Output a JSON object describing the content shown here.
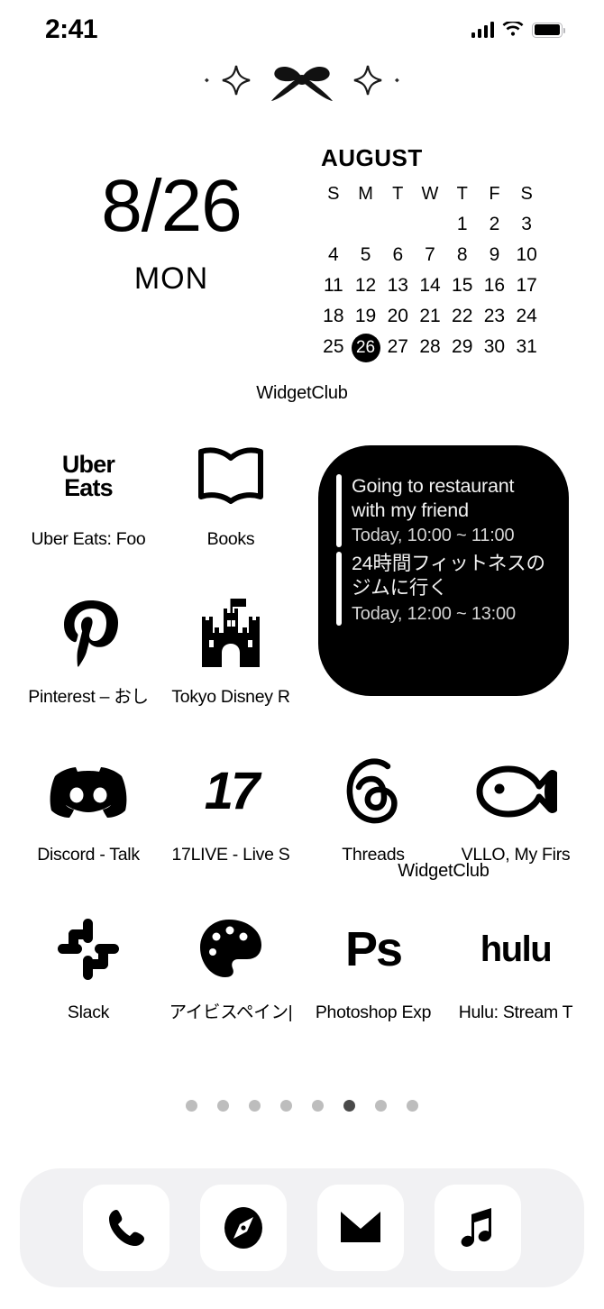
{
  "status_bar": {
    "time": "2:41",
    "signal_icon": "cellular-signal-icon",
    "wifi_icon": "wifi-icon",
    "battery_icon": "battery-full-icon"
  },
  "decoration": {
    "name": "bow-sparkles-decoration"
  },
  "date_widget": {
    "date": "8/26",
    "weekday": "MON",
    "label": "WidgetClub"
  },
  "calendar_widget": {
    "month": "AUGUST",
    "weekday_headers": [
      "S",
      "M",
      "T",
      "W",
      "T",
      "F",
      "S"
    ],
    "leading_blanks": 4,
    "days": [
      1,
      2,
      3,
      4,
      5,
      6,
      7,
      8,
      9,
      10,
      11,
      12,
      13,
      14,
      15,
      16,
      17,
      18,
      19,
      20,
      21,
      22,
      23,
      24,
      25,
      26,
      27,
      28,
      29,
      30,
      31
    ],
    "today": 26,
    "today_circle_color": "#000000"
  },
  "events_widget": {
    "label": "WidgetClub",
    "background": "#000000",
    "events": [
      {
        "title": "Going to restaurant with my friend",
        "time": "Today, 10:00 ~ 11:00"
      },
      {
        "title": "24時間フィットネスのジムに行く",
        "time": "Today, 12:00 ~ 13:00"
      }
    ]
  },
  "apps": {
    "row1": [
      {
        "label": "Uber Eats: Foo",
        "icon": "uber-eats-icon",
        "logo_line1": "Uber",
        "logo_line2": "Eats"
      },
      {
        "label": "Books",
        "icon": "books-icon"
      }
    ],
    "row2": [
      {
        "label": "Pinterest – おし",
        "icon": "pinterest-icon"
      },
      {
        "label": "Tokyo Disney R",
        "icon": "tokyo-disney-castle-icon"
      }
    ],
    "row3": [
      {
        "label": "Discord - Talk",
        "icon": "discord-icon"
      },
      {
        "label": "17LIVE - Live S",
        "icon": "17live-icon",
        "logo_text": "17"
      },
      {
        "label": "Threads",
        "icon": "threads-icon"
      },
      {
        "label": "VLLO, My Firs",
        "icon": "vllo-fish-icon"
      }
    ],
    "row4": [
      {
        "label": "Slack",
        "icon": "slack-icon"
      },
      {
        "label": "アイビスペイン|",
        "icon": "ibis-paint-palette-icon"
      },
      {
        "label": "Photoshop Exp",
        "icon": "photoshop-express-icon",
        "logo_text": "Ps"
      },
      {
        "label": "Hulu: Stream T",
        "icon": "hulu-icon",
        "logo_text": "hulu"
      }
    ]
  },
  "page_dots": {
    "count": 8,
    "active_index": 5,
    "inactive_color": "#bdbdbd",
    "active_color": "#4a4a4a"
  },
  "dock": {
    "background": "#f1f1f3",
    "items": [
      {
        "icon": "phone-icon",
        "name": "Phone"
      },
      {
        "icon": "safari-compass-icon",
        "name": "Safari"
      },
      {
        "icon": "mail-envelope-icon",
        "name": "Mail"
      },
      {
        "icon": "music-note-icon",
        "name": "Music"
      }
    ]
  },
  "theme": {
    "background": "#ffffff",
    "foreground": "#000000"
  }
}
